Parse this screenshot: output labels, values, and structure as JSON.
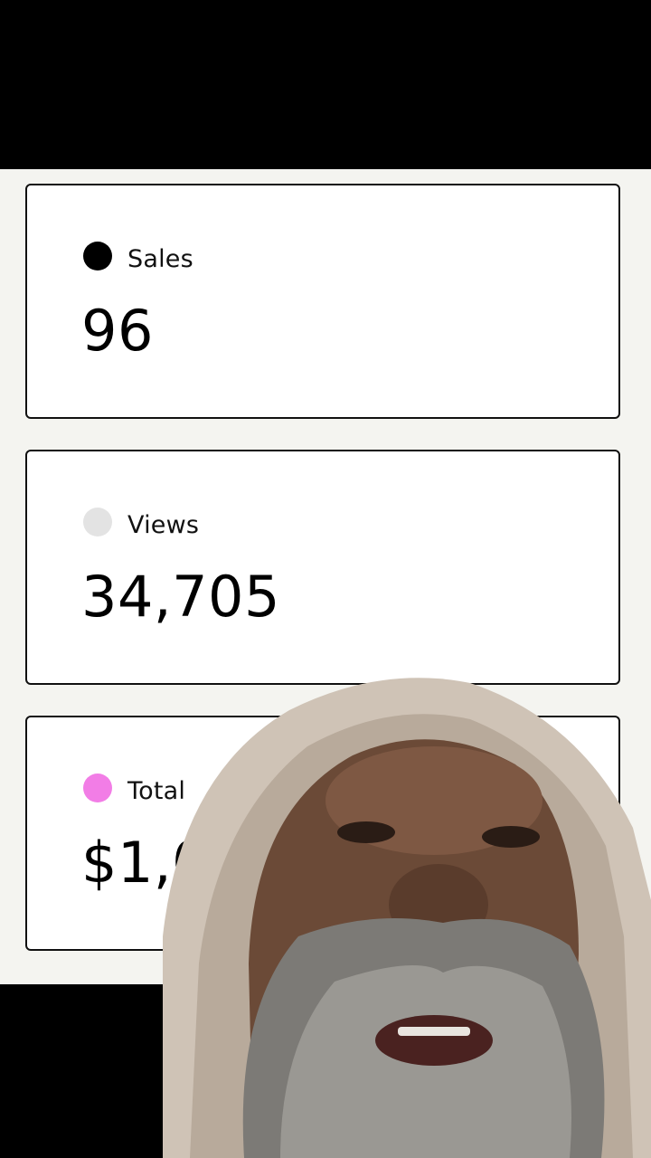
{
  "stats": [
    {
      "label": "Sales",
      "value": "96",
      "dot_color": "#000000"
    },
    {
      "label": "Views",
      "value": "34,705",
      "dot_color": "#e3e3e3"
    },
    {
      "label": "Total",
      "value": "$1,0",
      "dot_color": "#f27de6"
    }
  ],
  "overlay": {
    "icon": "person-video-overlay"
  }
}
